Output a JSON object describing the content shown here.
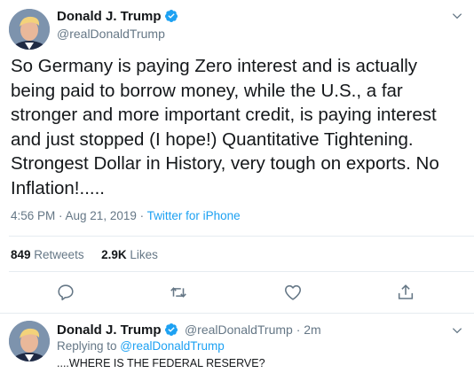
{
  "main_tweet": {
    "display_name": "Donald J. Trump",
    "handle": "@realDonaldTrump",
    "text": "So Germany is paying Zero interest and is actually being paid to borrow money, while the U.S., a far stronger and more important credit, is paying interest and just stopped (I hope!) Quantitative Tightening. Strongest Dollar in History, very tough on exports. No Inflation!.....",
    "timestamp": "4:56 PM · Aug 21, 2019 · ",
    "source": "Twitter for iPhone",
    "retweets_count": "849",
    "retweets_label": "Retweets",
    "likes_count": "2.9K",
    "likes_label": "Likes"
  },
  "reply_tweet": {
    "display_name": "Donald J. Trump",
    "handle_time": "@realDonaldTrump · 2m",
    "replying_prefix": "Replying to ",
    "replying_handle": "@realDonaldTrump",
    "text": "....WHERE IS THE FEDERAL RESERVE?"
  },
  "colors": {
    "accent": "#1da1f2",
    "secondary_text": "#657786",
    "divider": "#e6ecf0"
  },
  "icons": [
    "verified-badge-icon",
    "chevron-down-icon",
    "reply-icon",
    "retweet-icon",
    "like-icon",
    "share-icon"
  ]
}
